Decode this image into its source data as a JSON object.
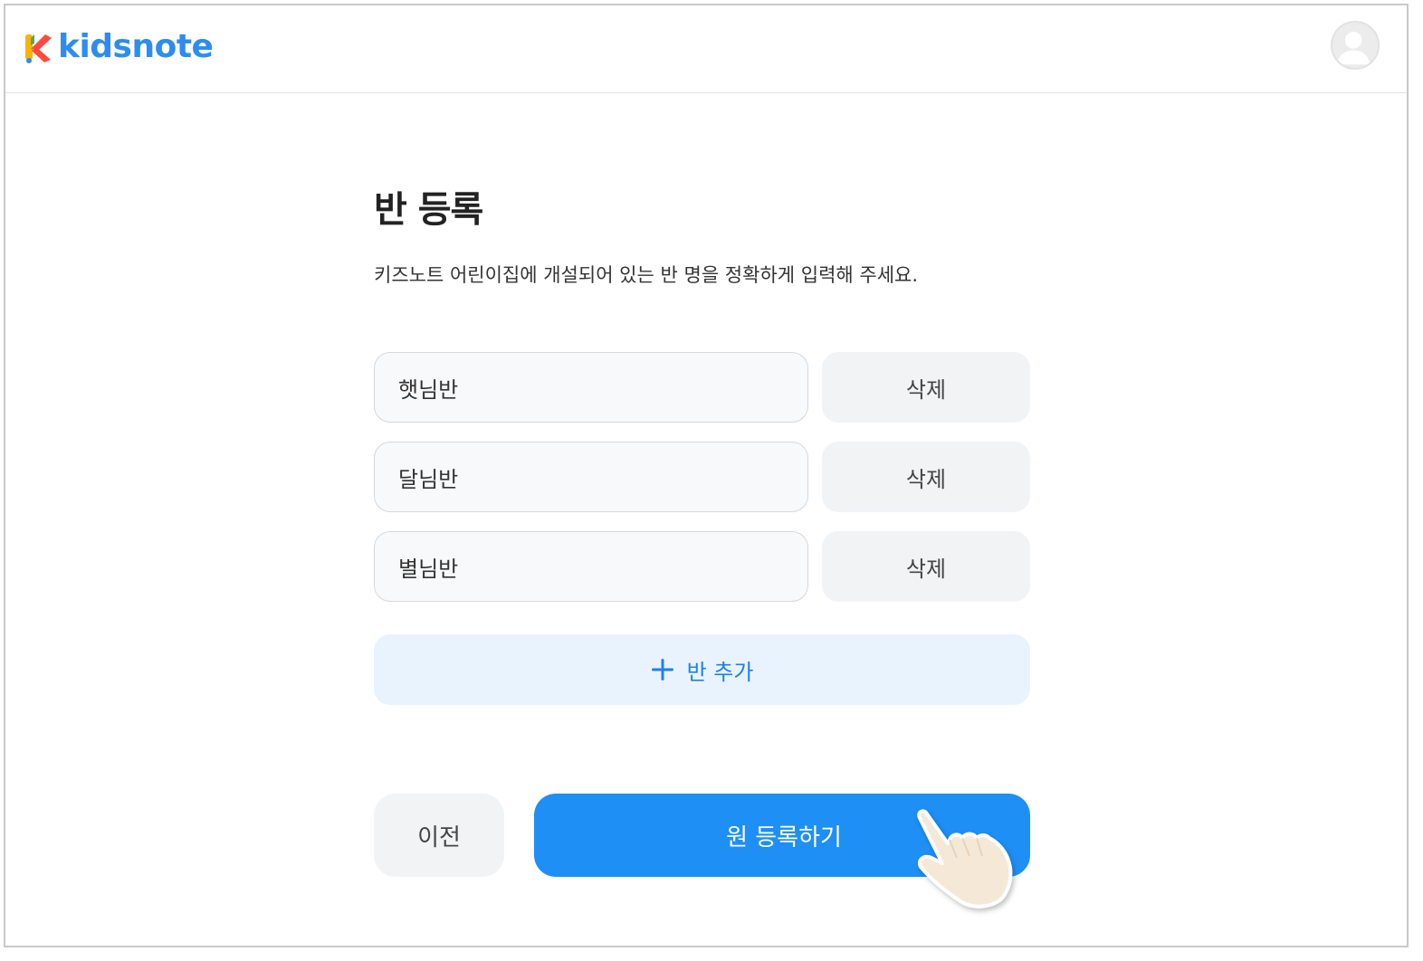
{
  "header": {
    "logo_text": "kidsnote",
    "avatar_icon": "user-avatar-icon"
  },
  "page": {
    "title": "반 등록",
    "description": "키즈노트 어린이집에 개설되어 있는 반 명을 정확하게 입력해 주세요."
  },
  "classes": [
    {
      "name": "햇님반",
      "delete_label": "삭제"
    },
    {
      "name": "달님반",
      "delete_label": "삭제"
    },
    {
      "name": "별님반",
      "delete_label": "삭제"
    }
  ],
  "actions": {
    "add_class_label": "반 추가",
    "add_class_icon": "plus-icon",
    "prev_label": "이전",
    "register_label": "원 등록하기",
    "pointer_icon": "hand-pointer-icon"
  },
  "colors": {
    "brand": "#2e8cf0",
    "primary_button": "#1e8ff5",
    "add_button_bg": "#e8f3fe",
    "add_button_text": "#2080e8",
    "secondary_button_bg": "#f2f3f5"
  }
}
